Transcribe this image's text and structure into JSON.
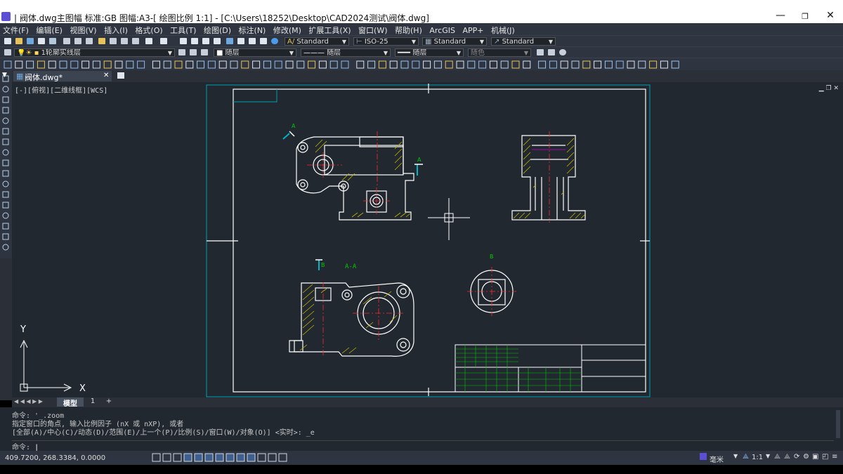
{
  "window": {
    "title": "| 阀体.dwg主图幅  标准:GB 图幅:A3-[ 绘图比例 1:1] - [C:\\Users\\18252\\Desktop\\CAD2024测试\\阀体.dwg]",
    "minimize": "—",
    "maximize": "❐",
    "close": "✕"
  },
  "menu": [
    "文件(F)",
    "编辑(E)",
    "视图(V)",
    "插入(I)",
    "格式(O)",
    "工具(T)",
    "绘图(D)",
    "标注(N)",
    "修改(M)",
    "扩展工具(X)",
    "窗口(W)",
    "帮助(H)",
    "ArcGIS",
    "APP+",
    "机械(J)"
  ],
  "toolbar1": {
    "text_style": "Standard",
    "dim_style": "ISO-25",
    "table_style": "Standard",
    "multileader_style": "Standard"
  },
  "toolbar2": {
    "layer": "1轮廓实线层",
    "color": "随层",
    "linetype": "随层",
    "lineweight": "随层",
    "plotstyle": "随色"
  },
  "doc_tab": {
    "name": "阀体.dwg*",
    "close": "✕"
  },
  "viewport": {
    "label": "[-][俯视][二维线框][WCS]",
    "controls": "▁ ❐ ✕"
  },
  "drawing": {
    "section_label": "A-A",
    "label_a": "A",
    "label_b": "B"
  },
  "ucs": {
    "x": "X",
    "y": "Y"
  },
  "layout_tabs": {
    "model": "模型",
    "layout1": "1",
    "add": "+"
  },
  "command": {
    "line1": "命令: '_.zoom",
    "line2": "指定窗口的角点, 输入比例因子 (nX 或 nXP), 或者",
    "line3": "[全部(A)/中心(C)/动态(D)/范围(E)/上一个(P)/比例(S)/窗口(W)/对象(O)] <实时>: _e",
    "prompt": "命令:"
  },
  "status": {
    "coords": "409.7200, 268.3384, 0.0000",
    "units": "毫米",
    "scale": "1:1"
  },
  "colors": {
    "outline": "#ffffff",
    "hatch": "#c8b400",
    "center": "#ff2a2a",
    "text": "#00c800",
    "cyan": "#00b4c8",
    "magenta": "#c800c8",
    "bg": "#212830"
  }
}
